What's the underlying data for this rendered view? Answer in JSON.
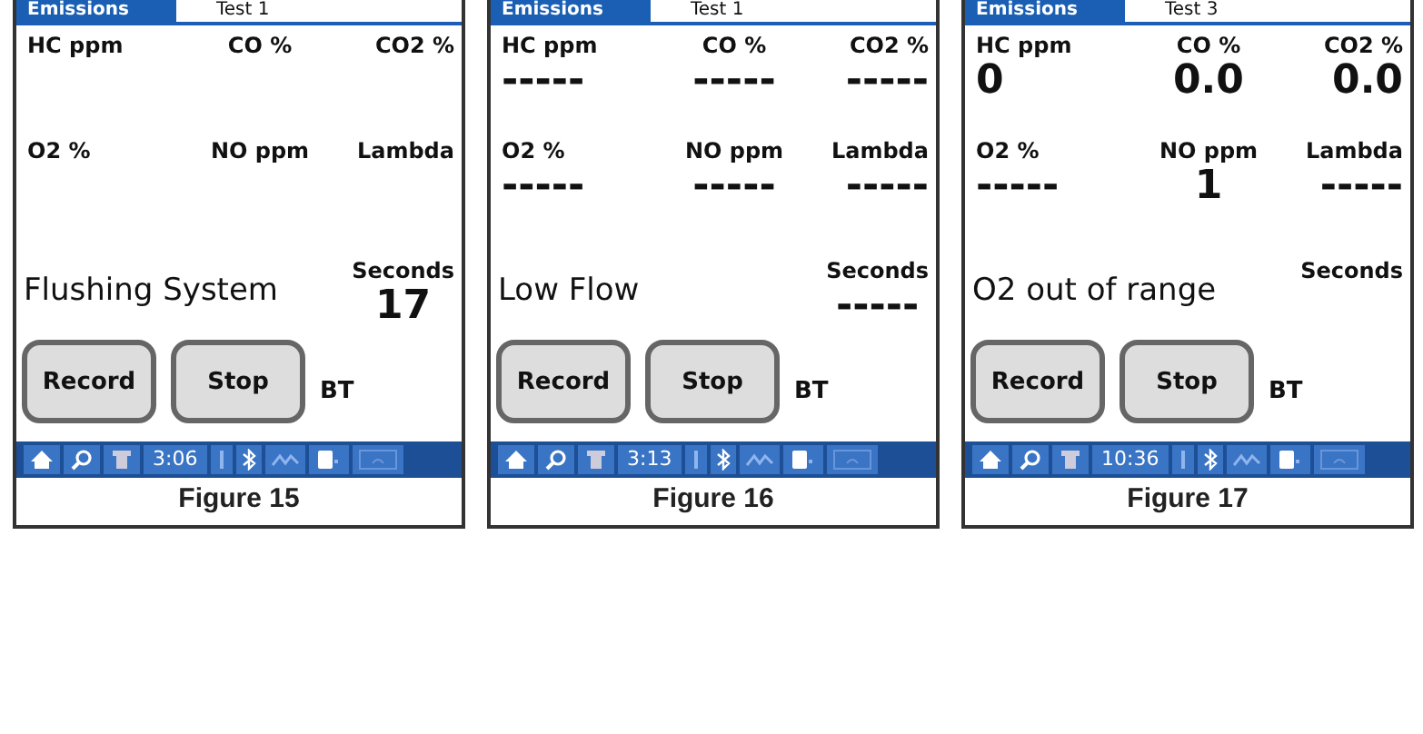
{
  "figures": [
    {
      "tab": "Emissions",
      "test": "Test 1",
      "readings": [
        {
          "label": "HC ppm"
        },
        {
          "label": "CO %"
        },
        {
          "label": "CO2 %"
        },
        {
          "label": "O2 %"
        },
        {
          "label": "NO ppm"
        },
        {
          "label": "Lambda"
        }
      ],
      "seconds_label": "Seconds",
      "seconds": "17",
      "status": "Flushing System",
      "buttons": [
        "Record",
        "Stop"
      ],
      "bt": "BT",
      "time": "3:06",
      "caption": "Figure 15"
    },
    {
      "tab": "Emissions",
      "test": "Test 1",
      "readings": [
        {
          "label": "HC ppm",
          "value": "-----"
        },
        {
          "label": "CO %",
          "value": "-----"
        },
        {
          "label": "CO2 %",
          "value": "-----"
        },
        {
          "label": "O2 %",
          "value": "-----"
        },
        {
          "label": "NO ppm",
          "value": "-----"
        },
        {
          "label": "Lambda",
          "value": "-----"
        }
      ],
      "seconds_label": "Seconds",
      "seconds": "-----",
      "status": "Low Flow",
      "buttons": [
        "Record",
        "Stop"
      ],
      "bt": "BT",
      "time": "3:13",
      "caption": "Figure 16"
    },
    {
      "tab": "Emissions",
      "test": "Test 3",
      "readings": [
        {
          "label": "HC ppm",
          "value": "0"
        },
        {
          "label": "CO %",
          "value": "0.0"
        },
        {
          "label": "CO2 %",
          "value": "0.0"
        },
        {
          "label": "O2 %",
          "value": "-----"
        },
        {
          "label": "NO ppm",
          "value": "1"
        },
        {
          "label": "Lambda",
          "value": "-----"
        }
      ],
      "seconds_label": "Seconds",
      "status": "O2 out of range",
      "buttons": [
        "Record",
        "Stop"
      ],
      "bt": "BT",
      "time": "10:36",
      "caption": "Figure 17"
    }
  ]
}
